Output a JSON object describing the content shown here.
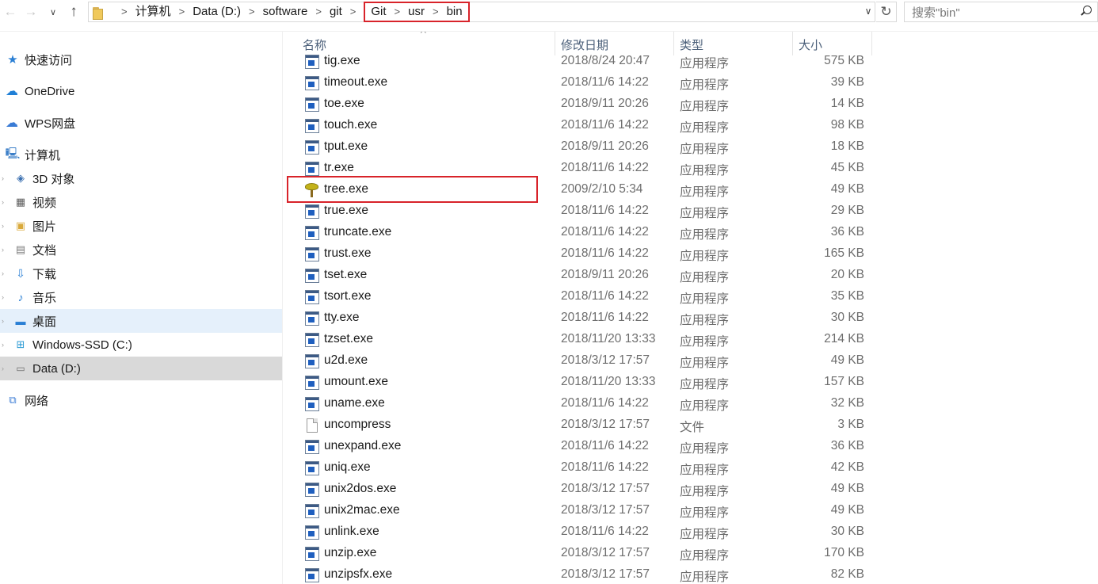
{
  "address_bar": {
    "breadcrumbs": [
      "计算机",
      "Data (D:)",
      "software",
      "git"
    ],
    "highlighted_breadcrumbs": [
      "Git",
      "usr",
      "bin"
    ]
  },
  "search": {
    "placeholder": "搜索\"bin\""
  },
  "nav_pane": {
    "items": [
      {
        "label": "快速访问",
        "icon": "star-icon"
      },
      {
        "label": "OneDrive",
        "icon": "cloud-icon"
      },
      {
        "label": "WPS网盘",
        "icon": "cloud-outline-icon"
      },
      {
        "label": "计算机",
        "icon": "computer-icon"
      },
      {
        "label": "3D 对象",
        "icon": "cube-icon"
      },
      {
        "label": "视频",
        "icon": "video-icon"
      },
      {
        "label": "图片",
        "icon": "picture-icon"
      },
      {
        "label": "文档",
        "icon": "document-icon"
      },
      {
        "label": "下载",
        "icon": "download-icon"
      },
      {
        "label": "音乐",
        "icon": "music-icon"
      },
      {
        "label": "桌面",
        "icon": "desktop-icon",
        "selected": true
      },
      {
        "label": "Windows-SSD (C:)",
        "icon": "windows-drive-icon"
      },
      {
        "label": "Data (D:)",
        "icon": "drive-icon",
        "active": true
      },
      {
        "label": "网络",
        "icon": "network-icon"
      }
    ]
  },
  "columns": {
    "name": "名称",
    "date": "修改日期",
    "type": "类型",
    "size": "大小"
  },
  "files": [
    {
      "name": "tig.exe",
      "date": "2018/8/24 20:47",
      "type": "应用程序",
      "size": "575 KB",
      "icon": "exe-icon"
    },
    {
      "name": "timeout.exe",
      "date": "2018/11/6 14:22",
      "type": "应用程序",
      "size": "39 KB",
      "icon": "exe-icon"
    },
    {
      "name": "toe.exe",
      "date": "2018/9/11 20:26",
      "type": "应用程序",
      "size": "14 KB",
      "icon": "exe-icon"
    },
    {
      "name": "touch.exe",
      "date": "2018/11/6 14:22",
      "type": "应用程序",
      "size": "98 KB",
      "icon": "exe-icon"
    },
    {
      "name": "tput.exe",
      "date": "2018/9/11 20:26",
      "type": "应用程序",
      "size": "18 KB",
      "icon": "exe-icon"
    },
    {
      "name": "tr.exe",
      "date": "2018/11/6 14:22",
      "type": "应用程序",
      "size": "45 KB",
      "icon": "exe-icon"
    },
    {
      "name": "tree.exe",
      "date": "2009/2/10 5:34",
      "type": "应用程序",
      "size": "49 KB",
      "icon": "tree-icon",
      "highlighted": true
    },
    {
      "name": "true.exe",
      "date": "2018/11/6 14:22",
      "type": "应用程序",
      "size": "29 KB",
      "icon": "exe-icon"
    },
    {
      "name": "truncate.exe",
      "date": "2018/11/6 14:22",
      "type": "应用程序",
      "size": "36 KB",
      "icon": "exe-icon"
    },
    {
      "name": "trust.exe",
      "date": "2018/11/6 14:22",
      "type": "应用程序",
      "size": "165 KB",
      "icon": "exe-icon"
    },
    {
      "name": "tset.exe",
      "date": "2018/9/11 20:26",
      "type": "应用程序",
      "size": "20 KB",
      "icon": "exe-icon"
    },
    {
      "name": "tsort.exe",
      "date": "2018/11/6 14:22",
      "type": "应用程序",
      "size": "35 KB",
      "icon": "exe-icon"
    },
    {
      "name": "tty.exe",
      "date": "2018/11/6 14:22",
      "type": "应用程序",
      "size": "30 KB",
      "icon": "exe-icon"
    },
    {
      "name": "tzset.exe",
      "date": "2018/11/20 13:33",
      "type": "应用程序",
      "size": "214 KB",
      "icon": "exe-icon"
    },
    {
      "name": "u2d.exe",
      "date": "2018/3/12 17:57",
      "type": "应用程序",
      "size": "49 KB",
      "icon": "exe-icon"
    },
    {
      "name": "umount.exe",
      "date": "2018/11/20 13:33",
      "type": "应用程序",
      "size": "157 KB",
      "icon": "exe-icon"
    },
    {
      "name": "uname.exe",
      "date": "2018/11/6 14:22",
      "type": "应用程序",
      "size": "32 KB",
      "icon": "exe-icon"
    },
    {
      "name": "uncompress",
      "date": "2018/3/12 17:57",
      "type": "文件",
      "size": "3 KB",
      "icon": "file-icon"
    },
    {
      "name": "unexpand.exe",
      "date": "2018/11/6 14:22",
      "type": "应用程序",
      "size": "36 KB",
      "icon": "exe-icon"
    },
    {
      "name": "uniq.exe",
      "date": "2018/11/6 14:22",
      "type": "应用程序",
      "size": "42 KB",
      "icon": "exe-icon"
    },
    {
      "name": "unix2dos.exe",
      "date": "2018/3/12 17:57",
      "type": "应用程序",
      "size": "49 KB",
      "icon": "exe-icon"
    },
    {
      "name": "unix2mac.exe",
      "date": "2018/3/12 17:57",
      "type": "应用程序",
      "size": "49 KB",
      "icon": "exe-icon"
    },
    {
      "name": "unlink.exe",
      "date": "2018/11/6 14:22",
      "type": "应用程序",
      "size": "30 KB",
      "icon": "exe-icon"
    },
    {
      "name": "unzip.exe",
      "date": "2018/3/12 17:57",
      "type": "应用程序",
      "size": "170 KB",
      "icon": "exe-icon"
    },
    {
      "name": "unzipsfx.exe",
      "date": "2018/3/12 17:57",
      "type": "应用程序",
      "size": "82 KB",
      "icon": "exe-icon"
    }
  ],
  "colors": {
    "highlight_border": "#d8232a",
    "selected_bg": "#e5f0fb",
    "active_bg": "#d9d9d9",
    "header_text": "#4c607a"
  }
}
